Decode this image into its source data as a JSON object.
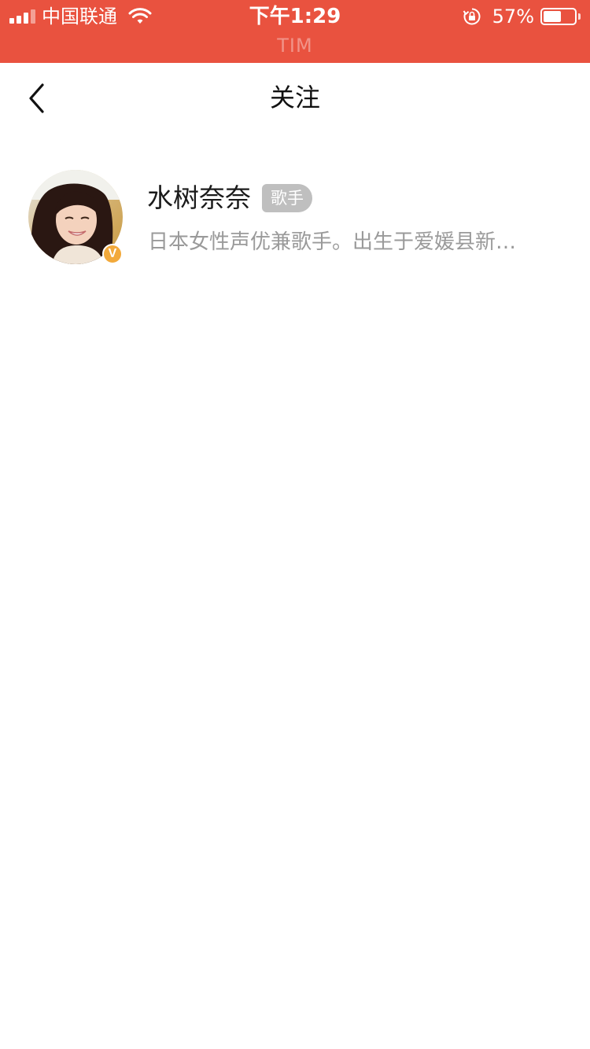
{
  "status_bar": {
    "carrier": "中国联通",
    "time": "下午1:29",
    "battery_percent": "57%",
    "battery_level": 0.57,
    "app_name": "TIM",
    "background_color": "#e9523f",
    "icons": [
      "signal-icon",
      "wifi-icon",
      "rotation-lock-icon",
      "battery-icon"
    ]
  },
  "nav": {
    "title": "关注",
    "back_icon": "chevron-left-icon"
  },
  "follow_list": [
    {
      "name": "水树奈奈",
      "tag": "歌手",
      "description": "日本女性声优兼歌手。出生于爱媛县新…",
      "verified_badge": "V",
      "verified_badge_color": "#f2a93b"
    }
  ]
}
